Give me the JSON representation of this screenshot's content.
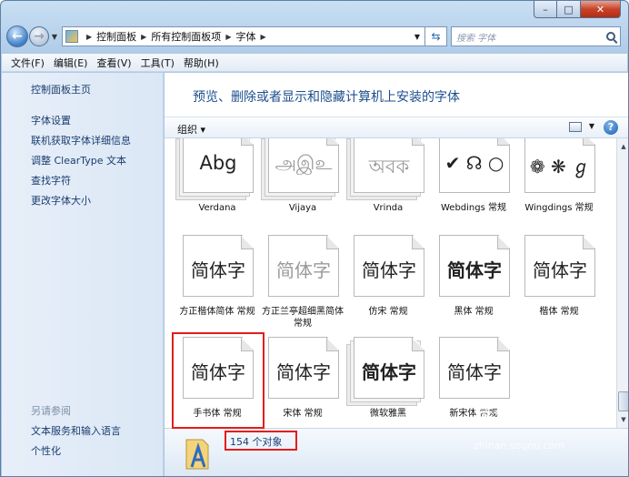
{
  "window": {
    "minimize": "–",
    "maximize": "□",
    "close": "✕"
  },
  "navigation": {
    "back": "←",
    "forward": "→",
    "breadcrumbs": [
      "控制面板",
      "所有控制面板项",
      "字体"
    ],
    "refresh": "⇆",
    "search_placeholder": "搜索 字体"
  },
  "menu": [
    "文件(F)",
    "编辑(E)",
    "查看(V)",
    "工具(T)",
    "帮助(H)"
  ],
  "sidebar": {
    "home": "控制面板主页",
    "links": [
      "字体设置",
      "联机获取字体详细信息",
      "调整 ClearType 文本",
      "查找字符",
      "更改字体大小"
    ],
    "see_also": "另请参阅",
    "bottom_links": [
      "文本服务和输入语言",
      "个性化"
    ]
  },
  "main": {
    "title": "预览、删除或者显示和隐藏计算机上安装的字体",
    "organize": "组织 ▾",
    "help": "?",
    "fonts": [
      {
        "name": "Verdana",
        "sample": "Abg",
        "stacked": true
      },
      {
        "name": "Vijaya",
        "sample": "அஇஉ",
        "stacked": true,
        "faded": true
      },
      {
        "name": "Vrinda",
        "sample": "অবক",
        "stacked": true,
        "faded": true
      },
      {
        "name": "Webdings 常规",
        "sample": "✔ ☊ ○",
        "stacked": false
      },
      {
        "name": "Wingdings 常规",
        "sample": "❁ ❋ ℊ",
        "stacked": false
      },
      {
        "name": "方正楷体简体 常规",
        "sample": "简体字",
        "stacked": false
      },
      {
        "name": "方正兰亭超细黑简体 常规",
        "sample": "简体字",
        "stacked": false,
        "faded": true
      },
      {
        "name": "仿宋 常规",
        "sample": "简体字",
        "stacked": false
      },
      {
        "name": "黑体 常规",
        "sample": "简体字",
        "stacked": false,
        "bold": true
      },
      {
        "name": "楷体 常规",
        "sample": "简体字",
        "stacked": false
      },
      {
        "name": "手书体 常规",
        "sample": "简体字",
        "stacked": false
      },
      {
        "name": "宋体 常规",
        "sample": "简体字",
        "stacked": false
      },
      {
        "name": "微软雅黑",
        "sample": "简体字",
        "stacked": true,
        "bold": true
      },
      {
        "name": "新宋体 常规",
        "sample": "简体字",
        "stacked": false
      }
    ],
    "status": "154 个对象"
  },
  "watermark": {
    "brand": "搜狗指南",
    "url": "zhinan.sogou.com"
  },
  "colors": {
    "highlight": "#e51c1c",
    "link": "#1a3d6e",
    "title": "#1d4f8e"
  }
}
